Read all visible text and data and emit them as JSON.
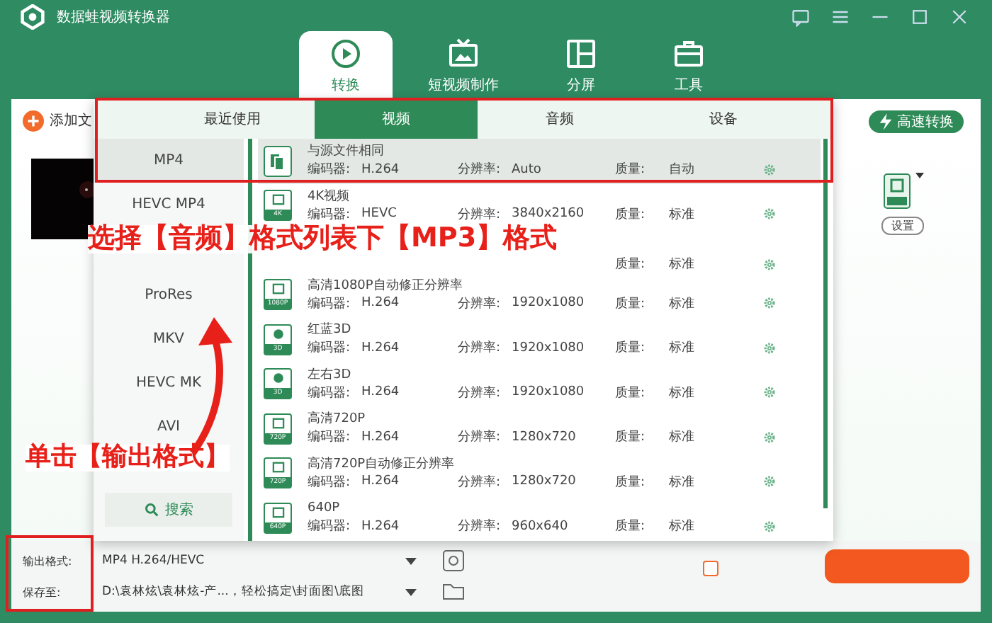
{
  "window": {
    "title": "数据蛙视频转换器"
  },
  "nav_tabs": [
    {
      "label": "转换",
      "selected": true,
      "kind": "convert"
    },
    {
      "label": "短视频制作",
      "selected": false,
      "kind": "video"
    },
    {
      "label": "分屏",
      "selected": false,
      "kind": "split"
    },
    {
      "label": "工具",
      "selected": false,
      "kind": "tools"
    }
  ],
  "toolbar": {
    "add_files": "添加文",
    "fast_convert": "高速转换"
  },
  "output_preset": {
    "settings": "设置"
  },
  "format_popup": {
    "tabs": [
      {
        "label": "最近使用",
        "selected": false
      },
      {
        "label": "视频",
        "selected": true
      },
      {
        "label": "音频",
        "selected": false
      },
      {
        "label": "设备",
        "selected": false
      }
    ],
    "formats": [
      {
        "label": "MP4",
        "selected": true
      },
      {
        "label": "HEVC MP4",
        "selected": false
      },
      {
        "label": "ProRes",
        "selected": false
      },
      {
        "label": "MKV",
        "selected": false
      },
      {
        "label": "HEVC MK",
        "selected": false
      },
      {
        "label": "AVI",
        "selected": false
      }
    ],
    "search": "搜索",
    "presets": [
      {
        "title": "与源文件相同",
        "encoder_label": "编码器:",
        "encoder": "H.264",
        "resolution_label": "分辨率:",
        "resolution": "Auto",
        "quality_label": "质量:",
        "quality": "自动",
        "selected": true,
        "kind": "copy"
      },
      {
        "title": "4K视频",
        "badge": "4K",
        "encoder_label": "编码器:",
        "encoder": "HEVC",
        "resolution_label": "分辨率:",
        "resolution": "3840x2160",
        "quality_label": "质量:",
        "quality": "标准",
        "selected": false,
        "kind": "film"
      },
      {
        "quality_label": "质量:",
        "quality": "标准",
        "selected": false,
        "kind": "hidden"
      },
      {
        "title": "高清1080P自动修正分辨率",
        "badge": "1080P",
        "encoder_label": "编码器:",
        "encoder": "H.264",
        "resolution_label": "分辨率:",
        "resolution": "1920x1080",
        "quality_label": "质量:",
        "quality": "标准",
        "selected": false,
        "kind": "film"
      },
      {
        "title": "红蓝3D",
        "badge": "3D",
        "encoder_label": "编码器:",
        "encoder": "H.264",
        "resolution_label": "分辨率:",
        "resolution": "1920x1080",
        "quality_label": "质量:",
        "quality": "标准",
        "selected": false,
        "kind": "glasses"
      },
      {
        "title": "左右3D",
        "badge": "3D",
        "encoder_label": "编码器:",
        "encoder": "H.264",
        "resolution_label": "分辨率:",
        "resolution": "1920x1080",
        "quality_label": "质量:",
        "quality": "标准",
        "selected": false,
        "kind": "glasses"
      },
      {
        "title": "高清720P",
        "badge": "720P",
        "encoder_label": "编码器:",
        "encoder": "H.264",
        "resolution_label": "分辨率:",
        "resolution": "1280x720",
        "quality_label": "质量:",
        "quality": "标准",
        "selected": false,
        "kind": "film"
      },
      {
        "title": "高清720P自动修正分辨率",
        "badge": "720P",
        "encoder_label": "编码器:",
        "encoder": "H.264",
        "resolution_label": "分辨率:",
        "resolution": "1280x720",
        "quality_label": "质量:",
        "quality": "标准",
        "selected": false,
        "kind": "film"
      },
      {
        "title": "640P",
        "badge": "640P",
        "encoder_label": "编码器:",
        "encoder": "H.264",
        "resolution_label": "分辨率:",
        "resolution": "960x640",
        "quality_label": "质量:",
        "quality": "标准",
        "selected": false,
        "kind": "film"
      }
    ]
  },
  "bottom_bar": {
    "output_format_label": "输出格式:",
    "output_format": "MP4 H.264/HEVC",
    "save_to_label": "保存至:",
    "save_to": "D:\\袁林炫\\袁林炫-产...，轻松搞定\\封面图\\底图",
    "merge": {
      "checked": false
    }
  },
  "annotations": {
    "select_hint": "选择【音频】格式列表下【MP3】格式",
    "click_hint": "单击【输出格式】"
  }
}
